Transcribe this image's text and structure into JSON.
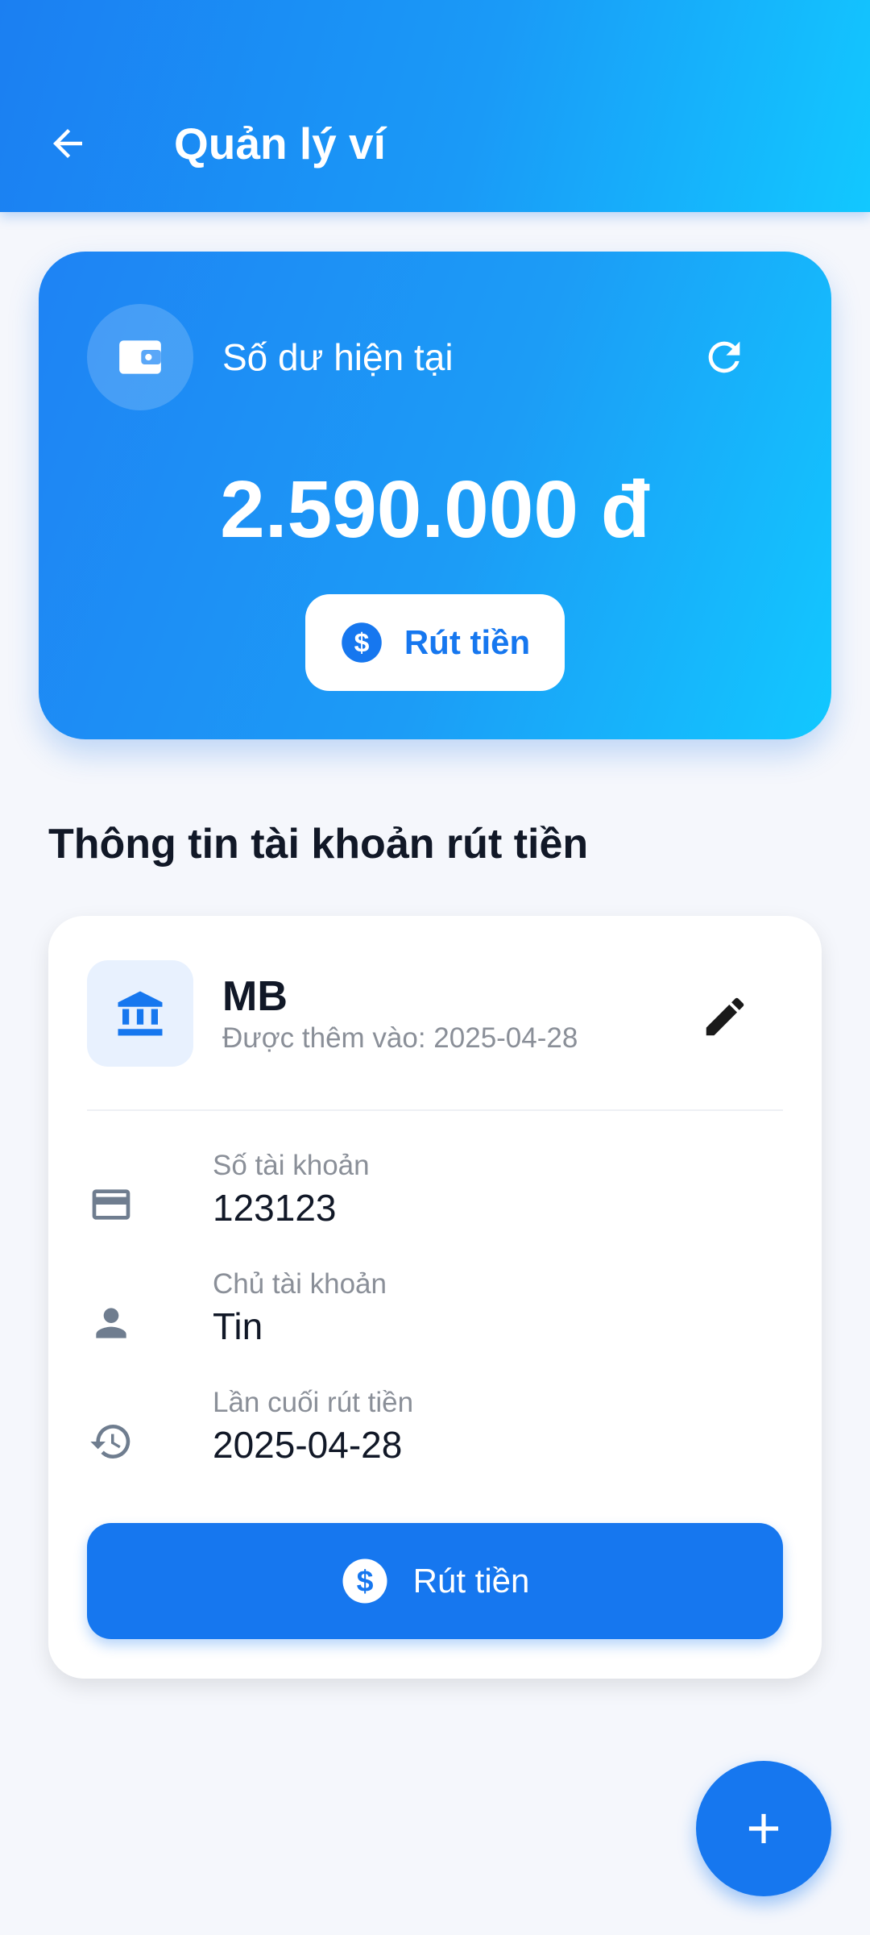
{
  "appbar": {
    "title": "Quản lý ví"
  },
  "balance": {
    "label": "Số dư hiện tại",
    "amount": "2.590.000 đ",
    "withdraw_label": "Rút tiền"
  },
  "section": {
    "title": "Thông tin tài khoản rút tiền"
  },
  "account": {
    "bank_name": "MB",
    "added_text": "Được thêm vào: 2025-04-28",
    "rows": [
      {
        "label": "Số tài khoản",
        "value": "123123",
        "icon": "credit-card-icon"
      },
      {
        "label": "Chủ tài khoản",
        "value": "Tin",
        "icon": "person-icon"
      },
      {
        "label": "Lần cuối rút tiền",
        "value": "2025-04-28",
        "icon": "history-icon"
      }
    ],
    "withdraw_label": "Rút tiền"
  },
  "fab": {
    "icon": "plus-icon"
  },
  "colors": {
    "primary": "#1677ef",
    "gradient_start": "#1b7ff2",
    "gradient_end": "#12c8ff",
    "background": "#f5f7fc",
    "text_dark": "#111827",
    "text_muted": "#8a8f98"
  }
}
